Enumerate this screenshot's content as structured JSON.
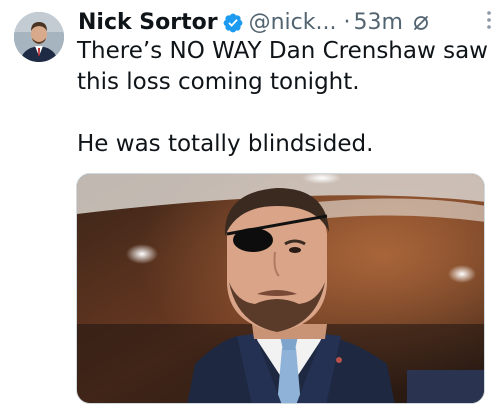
{
  "tweet": {
    "author": {
      "name": "Nick Sortor",
      "handle": "@nick...",
      "avatar_icon": "user-avatar",
      "verified_icon": "verified-badge-icon",
      "verified_color": "#1d9bf0"
    },
    "separator": "·",
    "timestamp": "53m",
    "edit_icon": "edited-icon",
    "more_icon": "more-options-icon",
    "text_lines": [
      "There’s NO WAY Dan Crenshaw saw this loss coming tonight.",
      "He was totally blindsided."
    ],
    "media": {
      "type": "photo"
    }
  },
  "colors": {
    "text_primary": "#0f1419",
    "text_secondary": "#536471",
    "accent": "#1d9bf0",
    "border": "#cfd9de"
  }
}
